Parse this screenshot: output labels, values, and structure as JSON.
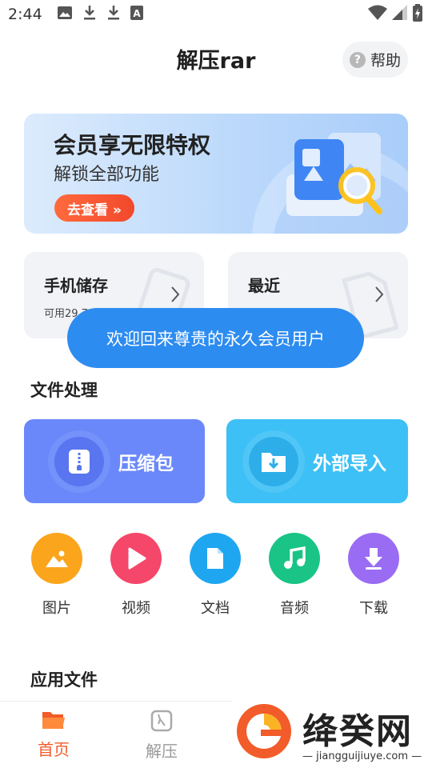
{
  "status_bar": {
    "time": "2:44",
    "left_icons": [
      "image-icon",
      "download-icon",
      "download-icon",
      "text-a-icon"
    ],
    "right_icons": [
      "wifi-icon",
      "signal-icon",
      "battery-icon"
    ]
  },
  "header": {
    "title": "解压rar",
    "help_label": "帮助",
    "help_icon": "question-circle-icon"
  },
  "banner": {
    "title": "会员享无限特权",
    "subtitle": "解锁全部功能",
    "button_label": "去查看 »"
  },
  "cards": [
    {
      "title": "手机储存",
      "subtitle": "可用29.79..."
    },
    {
      "title": "最近",
      "subtitle": "..."
    }
  ],
  "toast": {
    "text": "欢迎回来尊贵的永久会员用户"
  },
  "file_section": {
    "title": "文件处理"
  },
  "actions": [
    {
      "label": "压缩包",
      "icon": "zip-icon",
      "color": "#6a88fa"
    },
    {
      "label": "外部导入",
      "icon": "import-folder-icon",
      "color": "#3cc0f5"
    }
  ],
  "categories": [
    {
      "label": "图片",
      "icon": "image-icon",
      "color": "#fba51c"
    },
    {
      "label": "视频",
      "icon": "play-icon",
      "color": "#f5476a"
    },
    {
      "label": "文档",
      "icon": "document-icon",
      "color": "#1fa6f0"
    },
    {
      "label": "音频",
      "icon": "music-icon",
      "color": "#19c486"
    },
    {
      "label": "下载",
      "icon": "download-icon",
      "color": "#9a6cf3"
    }
  ],
  "app_section": {
    "title": "应用文件"
  },
  "bottom_nav": [
    {
      "label": "首页",
      "icon": "folder-icon",
      "active": true,
      "color": "#f25b2a"
    },
    {
      "label": "解压",
      "icon": "unzip-icon",
      "active": false,
      "color": "#999999"
    }
  ],
  "watermark": {
    "brand": "绛癸网",
    "url": "jiangguijiuye.com"
  }
}
